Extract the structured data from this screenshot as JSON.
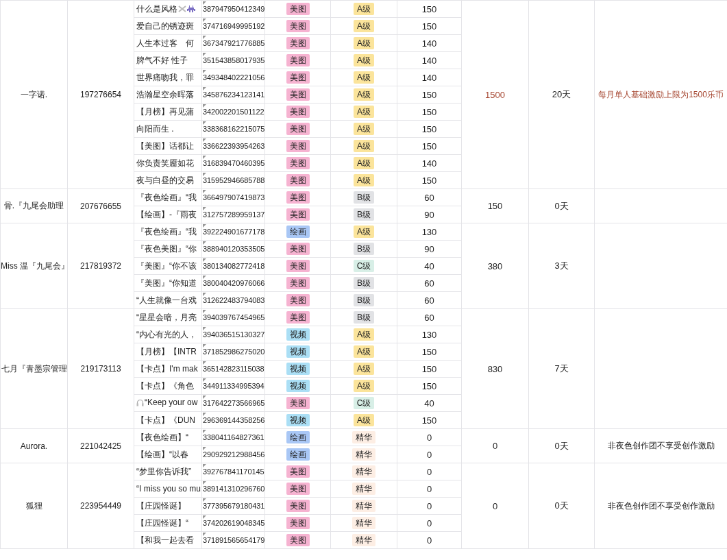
{
  "groups": [
    {
      "name": "一字诺.",
      "uid": "197276654",
      "total": "1500",
      "days": "20天",
      "note": "每月单人基础激励上限为1500乐币",
      "emphasis": true,
      "works": [
        {
          "kind": "with_emoji",
          "title": "什么是风格",
          "id": "387947950412349",
          "category": {
            "text": "美图",
            "color": "#f6b3d1"
          },
          "grade": {
            "text": "A级",
            "color": "#fbe49b"
          },
          "points": "150"
        },
        {
          "kind": "plain",
          "title": "爱自己的锈迹斑",
          "id": "374716949995192",
          "category": {
            "text": "美图",
            "color": "#f6b3d1"
          },
          "grade": {
            "text": "A级",
            "color": "#fbe49b"
          },
          "points": "150"
        },
        {
          "kind": "plain",
          "title": "人生本过客　何",
          "id": "367347921776885",
          "category": {
            "text": "美图",
            "color": "#f6b3d1"
          },
          "grade": {
            "text": "A级",
            "color": "#fbe49b"
          },
          "points": "140"
        },
        {
          "kind": "plain",
          "title": "脾气不好  性子",
          "id": "351543858017935",
          "category": {
            "text": "美图",
            "color": "#f6b3d1"
          },
          "grade": {
            "text": "A级",
            "color": "#fbe49b"
          },
          "points": "140"
        },
        {
          "kind": "plain",
          "title": "世界痛吻我，罪",
          "id": "349348402221056",
          "category": {
            "text": "美图",
            "color": "#f6b3d1"
          },
          "grade": {
            "text": "A级",
            "color": "#fbe49b"
          },
          "points": "140"
        },
        {
          "kind": "plain",
          "title": "浩瀚星空余晖落",
          "id": "345876234123141",
          "category": {
            "text": "美图",
            "color": "#f6b3d1"
          },
          "grade": {
            "text": "A级",
            "color": "#fbe49b"
          },
          "points": "150"
        },
        {
          "kind": "plain",
          "title": "【月榜】再见蒲",
          "id": "342002201501122",
          "category": {
            "text": "美图",
            "color": "#f6b3d1"
          },
          "grade": {
            "text": "A级",
            "color": "#fbe49b"
          },
          "points": "150"
        },
        {
          "kind": "plain",
          "title": "向阳而生  .",
          "id": "338368162215075",
          "category": {
            "text": "美图",
            "color": "#f6b3d1"
          },
          "grade": {
            "text": "A级",
            "color": "#fbe49b"
          },
          "points": "150"
        },
        {
          "kind": "plain",
          "title": "【美图】话都让",
          "id": "336622393954263",
          "category": {
            "text": "美图",
            "color": "#f6b3d1"
          },
          "grade": {
            "text": "A级",
            "color": "#fbe49b"
          },
          "points": "150"
        },
        {
          "kind": "plain",
          "title": "你负责笑靥如花",
          "id": "316839470460395",
          "category": {
            "text": "美图",
            "color": "#f6b3d1"
          },
          "grade": {
            "text": "A级",
            "color": "#fbe49b"
          },
          "points": "140"
        },
        {
          "kind": "plain",
          "title": "夜与白昼的交易",
          "id": "315952946685788",
          "category": {
            "text": "美图",
            "color": "#f6b3d1"
          },
          "grade": {
            "text": "A级",
            "color": "#fbe49b"
          },
          "points": "150"
        }
      ]
    },
    {
      "name": "骨.『九尾会助理",
      "uid": "207676655",
      "total": "150",
      "days": "0天",
      "emphasis": false,
      "works": [
        {
          "kind": "plain",
          "title": "『夜色绘画』“我",
          "id": "366497907419873",
          "category": {
            "text": "美图",
            "color": "#f6b3d1"
          },
          "grade": {
            "text": "B级",
            "color": "#e1e2e5"
          },
          "points": "60"
        },
        {
          "kind": "plain",
          "title": "【绘画】-『雨夜",
          "id": "312757289959137",
          "category": {
            "text": "美图",
            "color": "#f6b3d1"
          },
          "grade": {
            "text": "B级",
            "color": "#e1e2e5"
          },
          "points": "90"
        }
      ]
    },
    {
      "name": "Miss 温『九尾会』",
      "uid": "217819372",
      "total": "380",
      "days": "3天",
      "emphasis": false,
      "works": [
        {
          "kind": "plain",
          "title": "『夜色绘画』“我",
          "id": "392224901677178",
          "category": {
            "text": "绘画",
            "color": "#a9c7f5"
          },
          "grade": {
            "text": "A级",
            "color": "#fbe49b"
          },
          "points": "130"
        },
        {
          "kind": "plain",
          "title": "『夜色美图』“你",
          "id": "388940120353505",
          "category": {
            "text": "美图",
            "color": "#f6b3d1"
          },
          "grade": {
            "text": "B级",
            "color": "#e1e2e5"
          },
          "points": "90"
        },
        {
          "kind": "plain",
          "title": "『美图』“你不该",
          "id": "380134082772418",
          "category": {
            "text": "美图",
            "color": "#f6b3d1"
          },
          "grade": {
            "text": "C级",
            "color": "#d8efe7"
          },
          "points": "40"
        },
        {
          "kind": "plain",
          "title": "『美图』“你知道",
          "id": "380040420976066",
          "category": {
            "text": "美图",
            "color": "#f6b3d1"
          },
          "grade": {
            "text": "B级",
            "color": "#e1e2e5"
          },
          "points": "60"
        },
        {
          "kind": "plain",
          "title": "“人生就像一台戏",
          "id": "312622483794083",
          "category": {
            "text": "美图",
            "color": "#f6b3d1"
          },
          "grade": {
            "text": "B级",
            "color": "#e1e2e5"
          },
          "points": "60"
        }
      ]
    },
    {
      "name": "七月『青墨宗管理",
      "uid": "219173113",
      "total": "830",
      "days": "7天",
      "emphasis": false,
      "works": [
        {
          "kind": "plain",
          "title": "“星星会暗，月亮",
          "id": "394039767454965",
          "category": {
            "text": "美图",
            "color": "#f6b3d1"
          },
          "grade": {
            "text": "B级",
            "color": "#e1e2e5"
          },
          "points": "60"
        },
        {
          "kind": "plain",
          "title": "“内心有光的人，",
          "id": "394036515130327",
          "category": {
            "text": "视频",
            "color": "#abdff5"
          },
          "grade": {
            "text": "A级",
            "color": "#fbe49b"
          },
          "points": "130"
        },
        {
          "kind": "plain",
          "title": "【月榜】【INTR",
          "id": "371852986275020",
          "category": {
            "text": "视频",
            "color": "#abdff5"
          },
          "grade": {
            "text": "A级",
            "color": "#fbe49b"
          },
          "points": "150"
        },
        {
          "kind": "plain",
          "title": "【卡点】I'm mak",
          "id": "365142823115038",
          "category": {
            "text": "视频",
            "color": "#abdff5"
          },
          "grade": {
            "text": "A级",
            "color": "#fbe49b"
          },
          "points": "150"
        },
        {
          "kind": "plain",
          "title": "【卡点】《角色",
          "id": "344911334995394",
          "category": {
            "text": "视频",
            "color": "#abdff5"
          },
          "grade": {
            "text": "A级",
            "color": "#fbe49b"
          },
          "points": "150"
        },
        {
          "kind": "with_headphones",
          "title": "“Keep your ow",
          "id": "317642273566965",
          "category": {
            "text": "美图",
            "color": "#f6b3d1"
          },
          "grade": {
            "text": "C级",
            "color": "#d8efe7"
          },
          "points": "40"
        },
        {
          "kind": "plain",
          "title": "【卡点】《DUN",
          "id": "296369144358256",
          "category": {
            "text": "视频",
            "color": "#abdff5"
          },
          "grade": {
            "text": "A级",
            "color": "#fbe49b"
          },
          "points": "150"
        }
      ]
    },
    {
      "name": "Aurora.",
      "uid": "221042425",
      "total": "0",
      "days": "0天",
      "note": "非夜色创作团不享受创作激励",
      "emphasis": false,
      "works": [
        {
          "kind": "plain",
          "title": "【夜色绘画】“",
          "id": "338041164827361",
          "category": {
            "text": "绘画",
            "color": "#a9c7f5"
          },
          "grade": {
            "text": "精华",
            "color": "#fdeee4"
          },
          "points": "0"
        },
        {
          "kind": "plain",
          "title": "【绘画】“以春",
          "id": "290929212988456",
          "category": {
            "text": "绘画",
            "color": "#a9c7f5"
          },
          "grade": {
            "text": "精华",
            "color": "#fdeee4"
          },
          "points": "0"
        }
      ]
    },
    {
      "name": "狐狸",
      "uid": "223954449",
      "total": "0",
      "days": "0天",
      "note": "非夜色创作团不享受创作激励",
      "emphasis": false,
      "works": [
        {
          "kind": "plain",
          "title": "“梦里你告诉我”",
          "id": "392767841170145",
          "category": {
            "text": "美图",
            "color": "#f6b3d1"
          },
          "grade": {
            "text": "精华",
            "color": "#fdeee4"
          },
          "points": "0"
        },
        {
          "kind": "plain",
          "title": "“I miss you so mu",
          "id": "389141310296760",
          "category": {
            "text": "美图",
            "color": "#f6b3d1"
          },
          "grade": {
            "text": "精华",
            "color": "#fdeee4"
          },
          "points": "0"
        },
        {
          "kind": "plain",
          "title": "【庄园怪诞】",
          "id": "377395679180431",
          "category": {
            "text": "美图",
            "color": "#f6b3d1"
          },
          "grade": {
            "text": "精华",
            "color": "#fdeee4"
          },
          "points": "0"
        },
        {
          "kind": "plain",
          "title": "【庄园怪诞】“",
          "id": "374202619048345",
          "category": {
            "text": "美图",
            "color": "#f6b3d1"
          },
          "grade": {
            "text": "精华",
            "color": "#fdeee4"
          },
          "points": "0"
        },
        {
          "kind": "plain",
          "title": "【和我一起去看",
          "id": "371891565654179",
          "category": {
            "text": "美图",
            "color": "#f6b3d1"
          },
          "grade": {
            "text": "精华",
            "color": "#fdeee4"
          },
          "points": "0"
        }
      ]
    }
  ]
}
